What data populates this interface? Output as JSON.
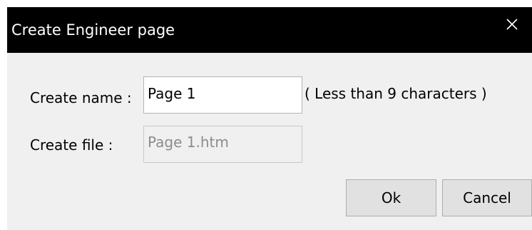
{
  "dialog": {
    "title": "Create Engineer page",
    "close_icon": "close-icon"
  },
  "form": {
    "name_label": "Create name :",
    "name_value": "Page 1",
    "name_hint": "( Less than 9 characters )",
    "file_label": "Create file :",
    "file_value": "Page 1.htm"
  },
  "buttons": {
    "ok_label": "Ok",
    "cancel_label": "Cancel"
  },
  "colors": {
    "titlebar": "#000000",
    "title_text": "#ffffff",
    "dialog_background": "#f0f0f0",
    "button_background": "#e1e1e1",
    "disabled_text": "#8c8c8c"
  }
}
